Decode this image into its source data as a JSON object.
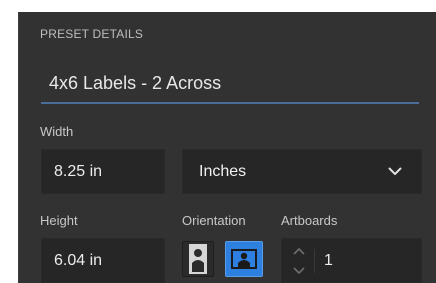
{
  "preset_details": {
    "section_title": "PRESET DETAILS",
    "name_value": "4x6 Labels - 2 Across"
  },
  "width": {
    "label": "Width",
    "value": "8.25 in"
  },
  "units": {
    "selected": "Inches"
  },
  "height": {
    "label": "Height",
    "value": "6.04 in"
  },
  "orientation": {
    "label": "Orientation",
    "options": [
      "portrait",
      "landscape"
    ],
    "selected": "landscape"
  },
  "artboards": {
    "label": "Artboards",
    "value": "1"
  },
  "colors": {
    "panel_bg": "#323232",
    "field_bg": "#262626",
    "accent": "#2d7fe0",
    "underline": "#4b6d9c"
  },
  "icons": [
    "portrait-orientation-icon",
    "landscape-orientation-icon",
    "chevron-down-icon",
    "stepper-up-icon",
    "stepper-down-icon"
  ]
}
